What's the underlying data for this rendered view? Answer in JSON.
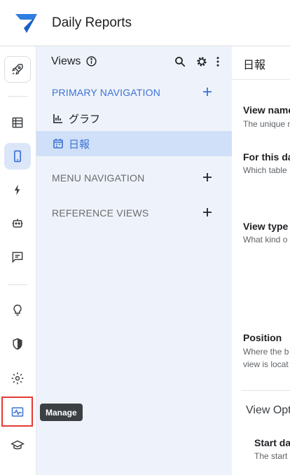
{
  "app": {
    "title": "Daily Reports",
    "accent": "#3d72d6",
    "logo_color": "#2f7de1"
  },
  "rail": {
    "items": [
      {
        "icon": "rocket-icon"
      },
      {
        "icon": "table-list-icon"
      },
      {
        "icon": "mobile-phone-icon",
        "active": true
      },
      {
        "icon": "bolt-icon"
      },
      {
        "icon": "bot-icon"
      },
      {
        "icon": "chat-icon"
      },
      {
        "icon": "lightbulb-icon"
      },
      {
        "icon": "shield-icon"
      },
      {
        "icon": "gear-icon"
      },
      {
        "icon": "manage-monitor-icon",
        "highlighted": true
      },
      {
        "icon": "graduation-cap-icon"
      }
    ],
    "tooltip": "Manage"
  },
  "views": {
    "title": "Views",
    "primary_label": "PRIMARY NAVIGATION",
    "items": [
      {
        "label": "グラフ",
        "icon": "bar-chart-icon",
        "selected": false
      },
      {
        "label": "日報",
        "icon": "calendar-icon",
        "selected": true
      }
    ],
    "menu_label": "MENU NAVIGATION",
    "reference_label": "REFERENCE VIEWS"
  },
  "detail": {
    "title": "日報",
    "fields": [
      {
        "label": "View name",
        "desc": "The unique n"
      },
      {
        "label": "For this da",
        "desc": "Which table"
      },
      {
        "label": "View type",
        "desc": "What kind o"
      },
      {
        "label": "Position",
        "desc": "Where the b",
        "desc2": "view is locat"
      }
    ],
    "options_title": "View Opt",
    "start_label": "Start da",
    "start_desc": "The start"
  }
}
